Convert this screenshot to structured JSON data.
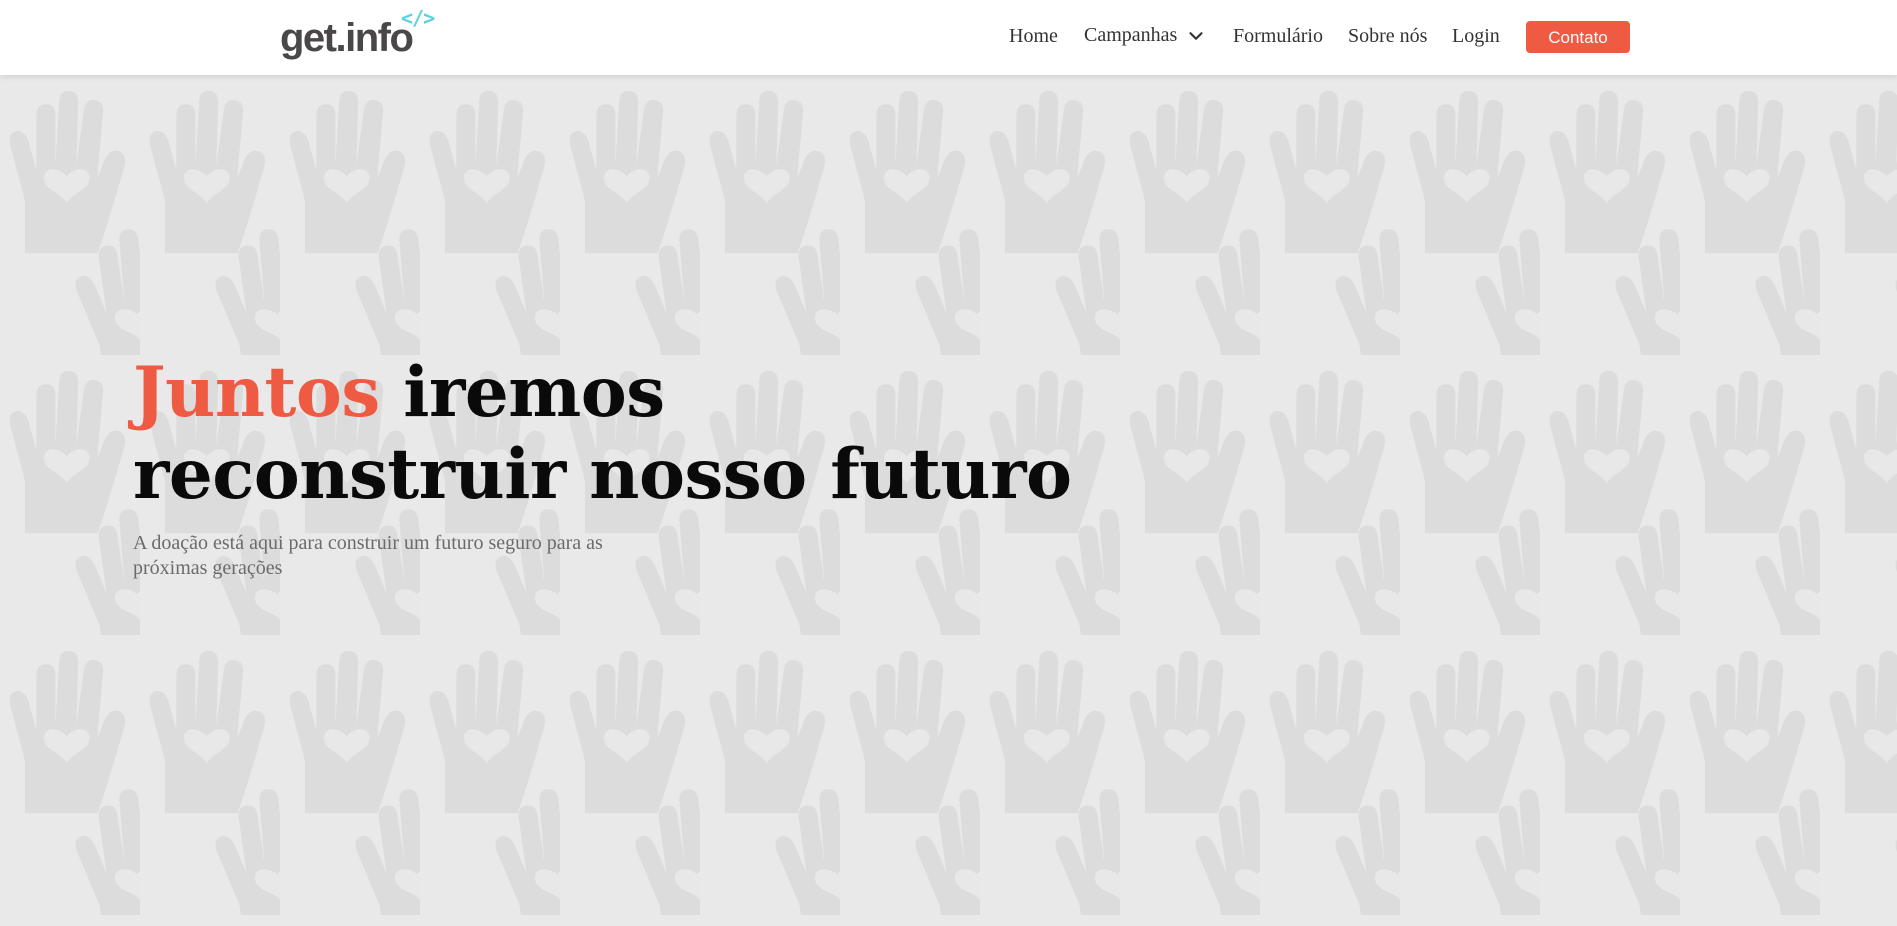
{
  "brand": {
    "logo_text": "get.info",
    "logo_code": "</>",
    "primary_color": "#ef5a43",
    "logo_accent_color": "#58d3d9"
  },
  "nav": {
    "items": [
      {
        "label": "Home"
      },
      {
        "label": "Campanhas",
        "icon": "chevron-down-icon"
      },
      {
        "label": "Formulário"
      },
      {
        "label": "Sobre nós"
      },
      {
        "label": "Login"
      }
    ],
    "cta_label": "Contato"
  },
  "hero": {
    "title_accent": "Juntos",
    "title_rest_line1": " iremos",
    "title_line2": "reconstruir nosso futuro",
    "subtitle": "A doação está aqui para construir um futuro seguro para as próximas gerações",
    "background_pattern": "hand-heart-icon"
  }
}
